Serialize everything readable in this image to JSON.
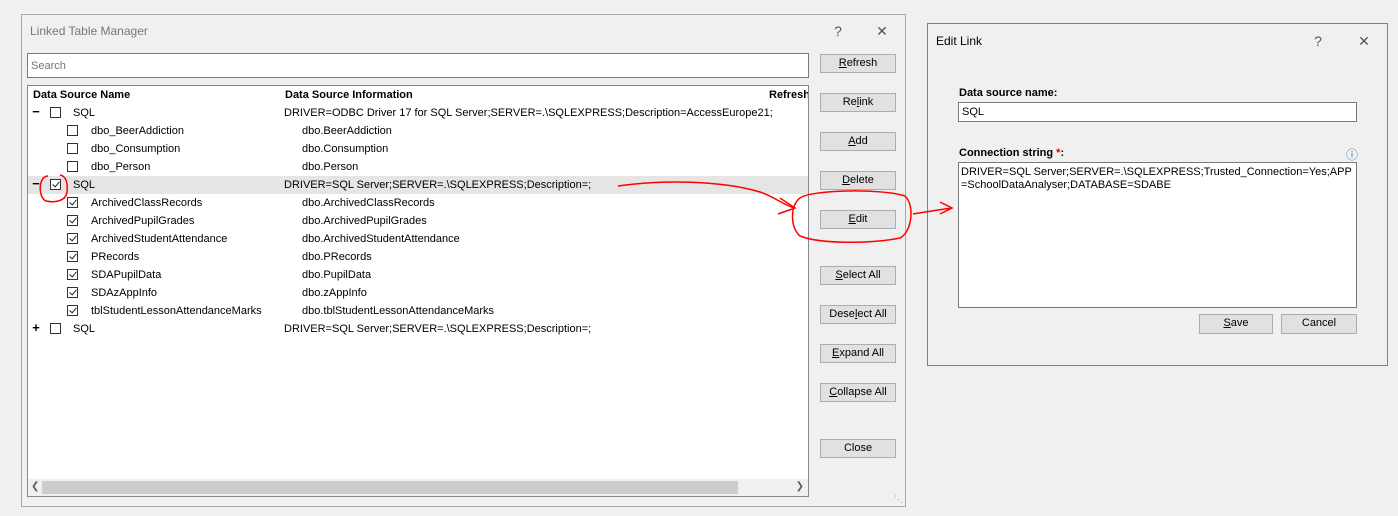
{
  "manager": {
    "title": "Linked Table Manager",
    "help": "?",
    "close": "✕",
    "search_placeholder": "Search",
    "columns": [
      "Data Source Name",
      "Data Source Information",
      "Refresh"
    ],
    "rows": [
      {
        "expander": "−",
        "checked": false,
        "name": "SQL",
        "info": "DRIVER=ODBC Driver 17 for SQL Server;SERVER=.\\SQLEXPRESS;Description=AccessEurope21;",
        "level": 0
      },
      {
        "expander": "",
        "checked": false,
        "name": "dbo_BeerAddiction",
        "info": "dbo.BeerAddiction",
        "level": 1
      },
      {
        "expander": "",
        "checked": false,
        "name": "dbo_Consumption",
        "info": "dbo.Consumption",
        "level": 1
      },
      {
        "expander": "",
        "checked": false,
        "name": "dbo_Person",
        "info": "dbo.Person",
        "level": 1
      },
      {
        "expander": "−",
        "checked": true,
        "name": "SQL",
        "info": "DRIVER=SQL Server;SERVER=.\\SQLEXPRESS;Description=;",
        "level": 0,
        "selected": true
      },
      {
        "expander": "",
        "checked": true,
        "name": "ArchivedClassRecords",
        "info": "dbo.ArchivedClassRecords",
        "level": 1
      },
      {
        "expander": "",
        "checked": true,
        "name": "ArchivedPupilGrades",
        "info": "dbo.ArchivedPupilGrades",
        "level": 1
      },
      {
        "expander": "",
        "checked": true,
        "name": "ArchivedStudentAttendance",
        "info": "dbo.ArchivedStudentAttendance",
        "level": 1
      },
      {
        "expander": "",
        "checked": true,
        "name": "PRecords",
        "info": "dbo.PRecords",
        "level": 1
      },
      {
        "expander": "",
        "checked": true,
        "name": "SDAPupilData",
        "info": "dbo.PupilData",
        "level": 1
      },
      {
        "expander": "",
        "checked": true,
        "name": "SDAzAppInfo",
        "info": "dbo.zAppInfo",
        "level": 1
      },
      {
        "expander": "",
        "checked": true,
        "name": "tblStudentLessonAttendanceMarks",
        "info": "dbo.tblStudentLessonAttendanceMarks",
        "level": 1
      },
      {
        "expander": "+",
        "checked": false,
        "name": "SQL",
        "info": "DRIVER=SQL Server;SERVER=.\\SQLEXPRESS;Description=;",
        "level": 0
      }
    ],
    "buttons": [
      {
        "id": "refresh",
        "pre": "",
        "key": "R",
        "post": "efresh"
      },
      {
        "id": "relink",
        "pre": "Re",
        "key": "l",
        "post": "ink"
      },
      {
        "id": "add",
        "pre": "",
        "key": "A",
        "post": "dd"
      },
      {
        "id": "delete",
        "pre": "",
        "key": "D",
        "post": "elete"
      },
      {
        "id": "edit",
        "pre": "",
        "key": "E",
        "post": "dit"
      },
      {
        "id": "select-all",
        "pre": "",
        "key": "S",
        "post": "elect All"
      },
      {
        "id": "deselect-all",
        "pre": "Dese",
        "key": "l",
        "post": "ect All"
      },
      {
        "id": "expand-all",
        "pre": "",
        "key": "E",
        "post": "xpand All"
      },
      {
        "id": "collapse-all",
        "pre": "",
        "key": "C",
        "post": "ollapse All"
      },
      {
        "id": "close",
        "pre": "Close",
        "key": "",
        "post": ""
      }
    ]
  },
  "edit_link": {
    "title": "Edit Link",
    "help": "?",
    "close": "✕",
    "ds_label": "Data source name:",
    "ds_value": "SQL",
    "conn_label": "Connection string",
    "required_mark": "*",
    "colon": ":",
    "info_icon": "ⓘ",
    "conn_value": "DRIVER=SQL Server;SERVER=.\\SQLEXPRESS;Trusted_Connection=Yes;APP=SchoolDataAnalyser;DATABASE=SDABE",
    "save_pre": "",
    "save_key": "S",
    "save_post": "ave",
    "cancel": "Cancel"
  },
  "colors": {
    "annotation": "#ff0000",
    "required": "#e00000"
  }
}
